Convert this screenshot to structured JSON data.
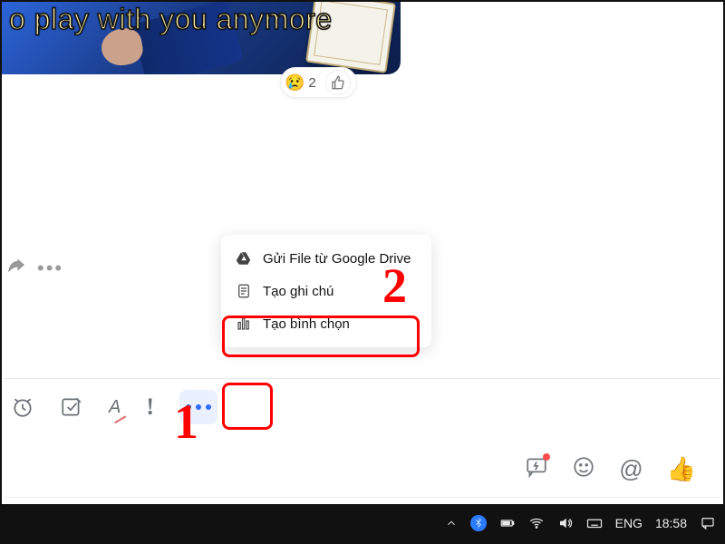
{
  "meme": {
    "caption_visible": "o play with you anymore"
  },
  "reactions": {
    "cry_emoji": "😢",
    "cry_count": "2",
    "like_emoji": "👍"
  },
  "popup": {
    "items": [
      {
        "label": "Gửi File từ Google Drive"
      },
      {
        "label": "Tạo ghi chú"
      },
      {
        "label": "Tạo bình chọn"
      }
    ]
  },
  "toolbar": {
    "format_label": "A",
    "priority_label": "!"
  },
  "composer_icons": {
    "mention": "@",
    "thumb": "👍"
  },
  "taskbar": {
    "lang": "ENG",
    "time": "18:58"
  },
  "annotations": {
    "step1": "1",
    "step2": "2"
  }
}
